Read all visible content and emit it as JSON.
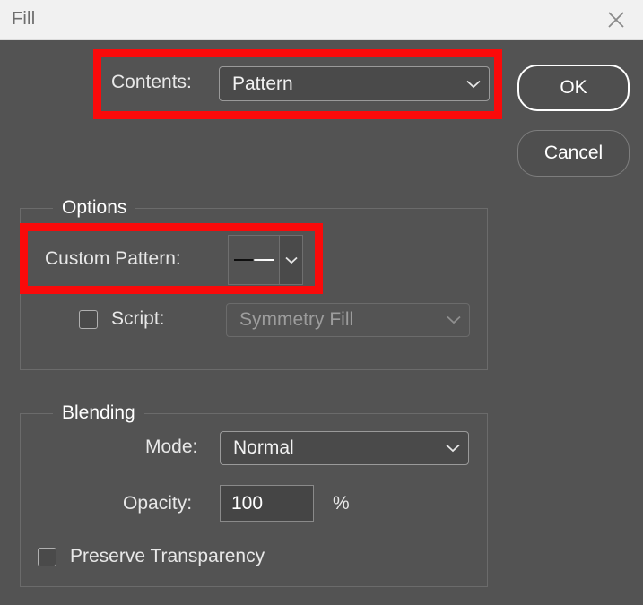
{
  "window": {
    "title": "Fill",
    "close_icon": "close-icon"
  },
  "contents": {
    "label": "Contents:",
    "value": "Pattern",
    "chevron_icon": "chevron-down-icon"
  },
  "buttons": {
    "ok": "OK",
    "cancel": "Cancel"
  },
  "options": {
    "title": "Options",
    "custom_pattern": {
      "label": "Custom Pattern:",
      "swatch_icon": "gradient-line-swatch",
      "chevron_icon": "chevron-down-icon"
    },
    "script": {
      "label": "Script:",
      "checked": false,
      "checkbox_icon": "checkbox-unchecked",
      "value": "Symmetry Fill",
      "disabled": true,
      "chevron_icon": "chevron-down-icon"
    }
  },
  "blending": {
    "title": "Blending",
    "mode": {
      "label": "Mode:",
      "value": "Normal",
      "chevron_icon": "chevron-down-icon"
    },
    "opacity": {
      "label": "Opacity:",
      "value": "100",
      "unit": "%"
    },
    "preserve_transparency": {
      "label": "Preserve Transparency",
      "checked": false,
      "checkbox_icon": "checkbox-unchecked"
    }
  },
  "annotations": {
    "color": "#fa0a0a",
    "boxes": [
      {
        "name": "contents-highlight"
      },
      {
        "name": "custom-pattern-highlight"
      }
    ]
  },
  "theme": {
    "dialog_background": "#535353",
    "titlebar_background": "#f1f1f1",
    "control_background": "#4a4a4a",
    "text_color": "#e8e8e8",
    "disabled_text_color": "#9d9d9d",
    "accent_border": "#ffffff"
  }
}
